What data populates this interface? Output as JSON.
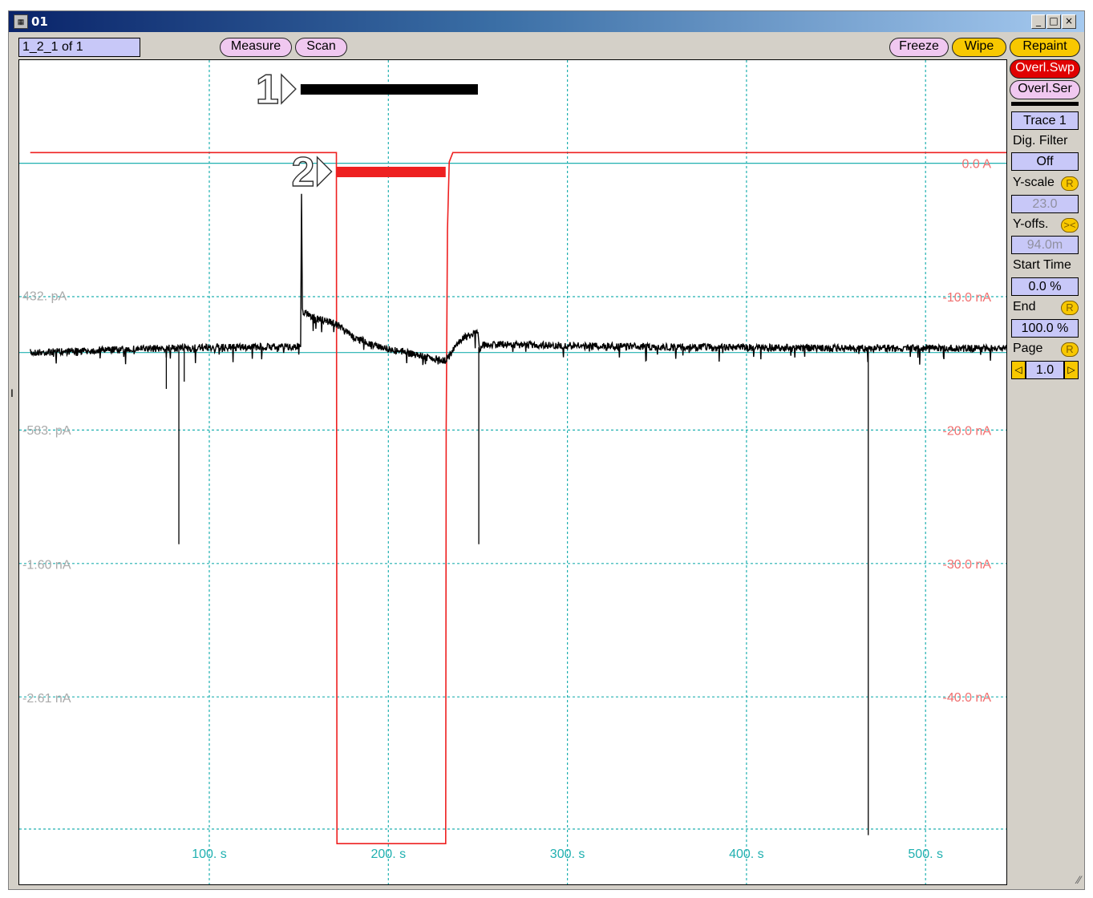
{
  "window": {
    "title": "01",
    "buttons": {
      "minimize": "_",
      "maximize": "□",
      "close": "×"
    }
  },
  "toolbar": {
    "sweep_label": "1_2_1 of 1",
    "measure": "Measure",
    "scan": "Scan",
    "freeze": "Freeze",
    "wipe": "Wipe",
    "repaint": "Repaint"
  },
  "panel": {
    "overl_swp": "Overl.Swp",
    "overl_ser": "Overl.Ser",
    "trace": "Trace 1",
    "dig_filter_label": "Dig. Filter",
    "dig_filter_value": "Off",
    "y_scale_label": "Y-scale",
    "y_scale_value": "23.0",
    "y_offs_label": "Y-offs.",
    "y_offs_value": "94.0m",
    "start_time_label": "Start Time",
    "start_time_value": "0.0 %",
    "end_label": "End",
    "end_value": "100.0 %",
    "page_label": "Page",
    "page_value": "1.0",
    "badge_r": "R",
    "badge_offs": "><",
    "arrow_left": "◁",
    "arrow_right": "▷"
  },
  "chart_data": {
    "type": "line",
    "x_axis": {
      "unit": "s",
      "range": [
        0,
        555
      ],
      "ticks": [
        100,
        200,
        300,
        400,
        500
      ],
      "tick_labels": [
        "100. s",
        "200. s",
        "300. s",
        "400. s",
        "500. s"
      ]
    },
    "y_axis_left": {
      "unit": "A",
      "ticks": [
        4.32e-10,
        -5.83e-10,
        -1.6e-09,
        -2.61e-09
      ],
      "tick_labels": [
        "432. pA",
        "-583. pA",
        "-1.60 nA",
        "-2.61 nA"
      ],
      "color": "#aaaaaa"
    },
    "y_axis_right": {
      "unit": "A",
      "ticks": [
        0,
        -1e-08,
        -2e-08,
        -3e-08,
        -4e-08
      ],
      "tick_labels": [
        "0.0 A",
        "-10.0 nA",
        "-20.0 nA",
        "-30.0 nA",
        "-40.0 nA"
      ],
      "color": "#f07070"
    },
    "grid": true,
    "grid_color": "#20b0b0",
    "annotations": [
      {
        "label": "1",
        "color": "#000000",
        "x_start": 151,
        "x_end": 250
      },
      {
        "label": "2",
        "color": "#ee2020",
        "x_start": 171,
        "x_end": 232
      }
    ],
    "series": [
      {
        "color": "#ee2020",
        "x": [
          0,
          171,
          171.3,
          232,
          232.3,
          233,
          234,
          236,
          555
        ],
        "y": [
          8e-10,
          8e-10,
          -5.1e-08,
          -5.1e-08,
          -2e-08,
          -5e-09,
          1e-10,
          8e-10,
          8e-10
        ]
      },
      {
        "color": "#000000",
        "x": [
          0,
          20,
          40,
          60,
          80,
          100,
          120,
          140,
          150,
          151,
          151.5,
          152,
          160,
          170,
          175,
          180,
          190,
          200,
          210,
          220,
          230,
          232,
          236,
          240,
          250,
          251,
          252,
          260,
          280,
          300,
          350,
          400,
          450,
          500,
          555
        ],
        "y": [
          -1e-12,
          8e-12,
          1.8e-11,
          2.8e-11,
          3.3e-11,
          3.7e-11,
          4e-11,
          4.3e-11,
          4.6e-11,
          4.6e-11,
          1.2e-09,
          3.15e-10,
          2.55e-10,
          2.25e-10,
          1.76e-10,
          1.18e-10,
          6.8e-11,
          2.8e-11,
          -2e-12,
          -2.8e-11,
          -5.8e-11,
          -6.2e-11,
          1.6e-11,
          9.8e-11,
          1.55e-10,
          -1.5e-11,
          5.5e-11,
          6.2e-11,
          5.7e-11,
          5.1e-11,
          4.2e-11,
          3.7e-11,
          3.4e-11,
          3.1e-11,
          3.1e-11
        ]
      }
    ],
    "spikes": [
      {
        "x": 76,
        "y_min": -2.75e-10
      },
      {
        "x": 83,
        "y_min": -1.45e-09
      },
      {
        "x": 86,
        "y_min": -2.2e-10
      },
      {
        "x": 250.5,
        "y_min": -1.45e-09
      },
      {
        "x": 468,
        "y_min": -3.65e-09
      }
    ]
  }
}
